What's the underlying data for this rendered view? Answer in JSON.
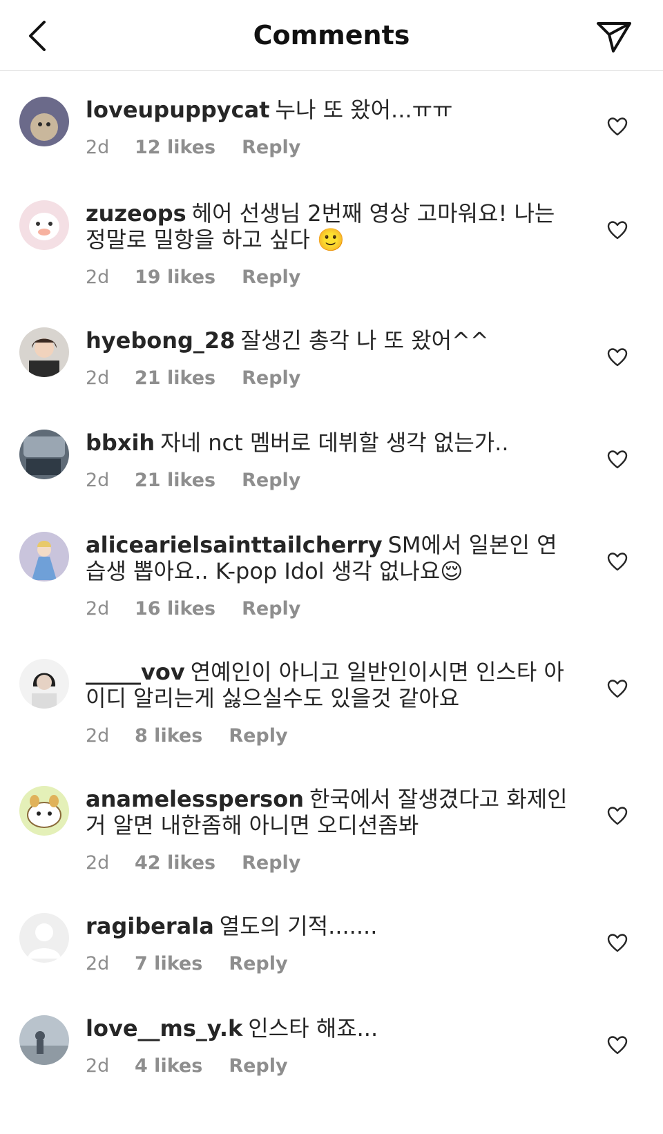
{
  "header": {
    "title": "Comments"
  },
  "comments": [
    {
      "username": "loveupuppycat",
      "text": "누나 또 왔어...ㅠㅠ",
      "time": "2d",
      "likes": "12 likes",
      "reply": "Reply"
    },
    {
      "username": "zuzeops",
      "text": "헤어 선생님 2번째 영상 고마워요! 나는 정말로 밀항을 하고 싶다 🙂",
      "time": "2d",
      "likes": "19 likes",
      "reply": "Reply"
    },
    {
      "username": "hyebong_28",
      "text": "잘생긴 총각 나 또 왔어^^",
      "time": "2d",
      "likes": "21 likes",
      "reply": "Reply"
    },
    {
      "username": "bbxih",
      "text": "자네 nct 멤버로 데뷔할 생각 없는가..",
      "time": "2d",
      "likes": "21 likes",
      "reply": "Reply"
    },
    {
      "username": "alicearielsainttailcherry",
      "text": "SM에서 일본인 연습생 뽑아요.. K-pop Idol 생각 없나요😌",
      "time": "2d",
      "likes": "16 likes",
      "reply": "Reply"
    },
    {
      "username": "_____vov",
      "text": "연예인이 아니고 일반인이시면 인스타 아이디 알리는게 싫으실수도 있을것 같아요",
      "time": "2d",
      "likes": "8 likes",
      "reply": "Reply"
    },
    {
      "username": "anamelessperson",
      "text": "한국에서 잘생겼다고 화제인거 알면 내한좀해 아니면 오디션좀봐",
      "time": "2d",
      "likes": "42 likes",
      "reply": "Reply"
    },
    {
      "username": "ragiberala",
      "text": "열도의 기적.......",
      "time": "2d",
      "likes": "7 likes",
      "reply": "Reply"
    },
    {
      "username": "love__ms_y.k",
      "text": "인스타 해죠...",
      "time": "2d",
      "likes": "4 likes",
      "reply": "Reply"
    }
  ],
  "colors": {
    "text": "#262626",
    "meta": "#8e8e8e",
    "divider": "#dbdbdb"
  },
  "icons": [
    "back-arrow-icon",
    "send-icon",
    "heart-icon"
  ]
}
